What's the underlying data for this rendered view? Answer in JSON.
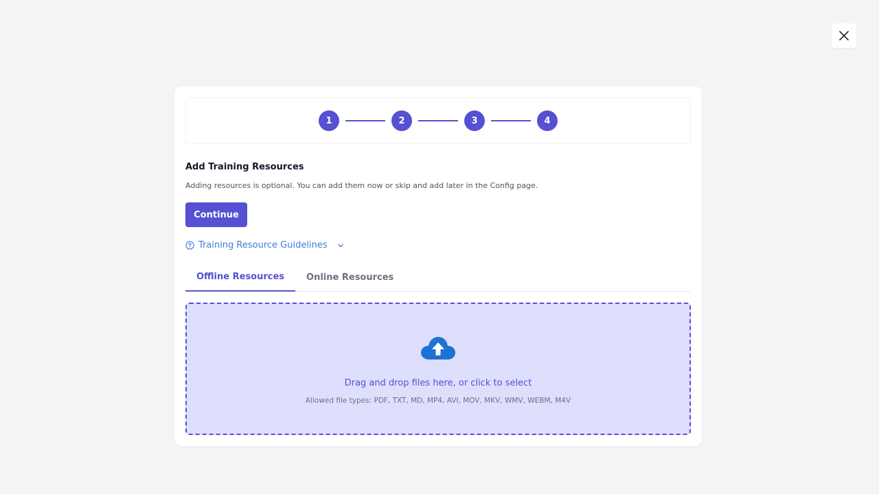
{
  "steps": [
    "1",
    "2",
    "3",
    "4"
  ],
  "title": "Add Training Resources",
  "subtitle": "Adding resources is optional. You can add them now or skip and add later in the Config page.",
  "continue_label": "Continue",
  "guidelines_label": "Training Resource Guidelines",
  "tabs": [
    {
      "label": "Offline Resources",
      "active": true
    },
    {
      "label": "Online Resources",
      "active": false
    }
  ],
  "dropzone": {
    "instruction": "Drag and drop files here, or click to select",
    "allowed_types": "Allowed file types: PDF, TXT, MD, MP4, AVI, MOV, MKV, WMV, WEBM, M4V"
  },
  "icons": {
    "close": "close-icon",
    "help": "help-circle-icon",
    "chevron": "chevron-down-icon",
    "upload": "cloud-upload-icon"
  },
  "colors": {
    "accent": "#5650d3",
    "link": "#3b7dde",
    "dropzone_bg": "#dddffd",
    "upload_icon": "#1e73d2"
  }
}
